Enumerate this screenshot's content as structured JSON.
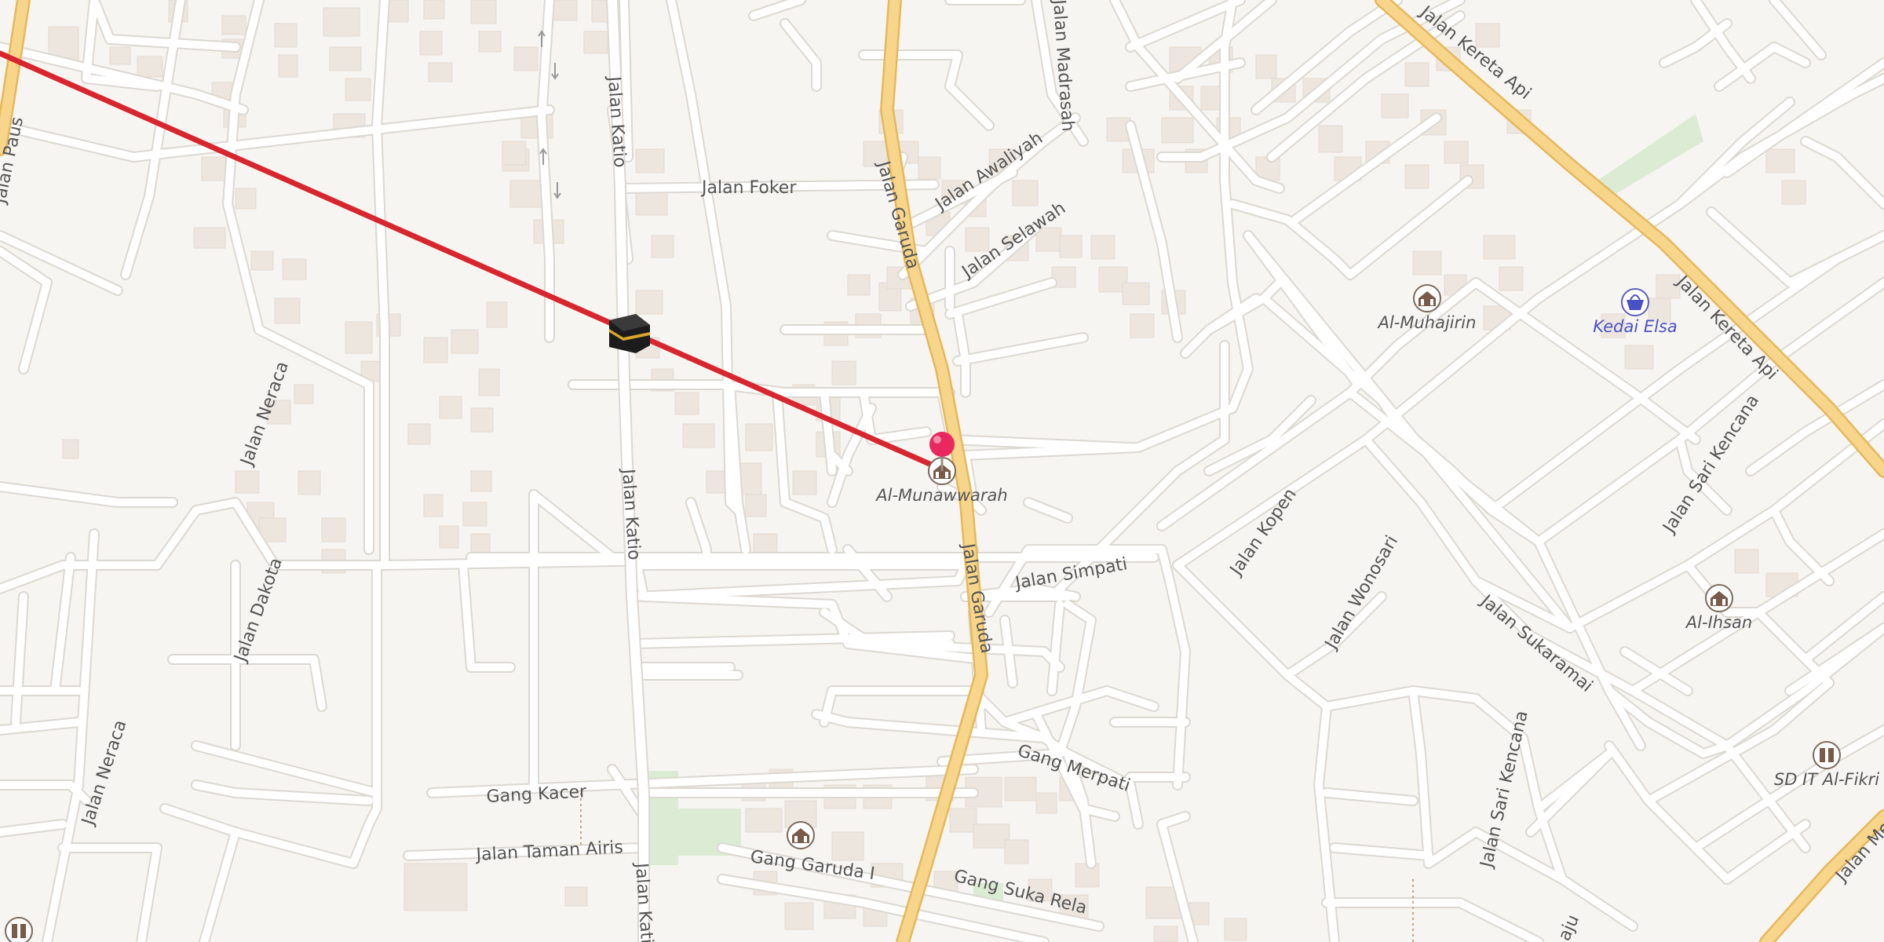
{
  "map": {
    "streets": {
      "paus": "Jalan Paus",
      "katio_top": "Jalan Katio",
      "katio_mid": "Jalan Katio",
      "katio_bot": "Jalan Kati",
      "foker": "Jalan Foker",
      "garuda_top": "Jalan Garuda",
      "garuda_mid": "Jalan Garuda",
      "madrasah": "Jalan Madrasah",
      "awaliyah": "Jalan Awaliyah",
      "selawah": "Jalan Selawah",
      "kereta_api_top": "Jalan Kereta Api",
      "kereta_api_mid": "Jalan Kereta Api",
      "neraca_top": "Jalan Neraca",
      "neraca_bot": "Jalan Neraca",
      "dakota": "Jalan Dakota",
      "simpati": "Jalan Simpati",
      "kopen": "Jalan Kopen",
      "wonosari": "Jalan Wonosari",
      "sukaramai": "Jalan Sukaramai",
      "sari_kencana_top": "Jalan Sari Kencana",
      "sari_kencana_bot": "Jalan Sari Kencana",
      "gang_kacer": "Gang Kacer",
      "gang_merpati": "Gang Merpati",
      "taman_airis": "Jalan Taman Airis",
      "gang_garuda": "Gang Garuda I",
      "gang_suka_rela": "Gang Suka Rela",
      "mer_edge": "Jalan Mer",
      "aju_edge": "aju"
    },
    "pois": {
      "munawwarah": "Al-Munawwarah",
      "muhajirin": "Al-Muhajirin",
      "kedai_elsa": "Kedai Elsa",
      "ihsan": "Al-Ihsan",
      "sd_it": "SD IT Al-Fikri"
    },
    "colors": {
      "background": "#f7f5f2",
      "road": "#ffffff",
      "road_casing": "#dcd8d2",
      "major_road": "#f7d58a",
      "major_casing": "#e6b85c",
      "building": "#ece6df",
      "park": "#dcebd3",
      "qibla_line": "#d7262e",
      "pin": "#e8285f"
    },
    "icons": {
      "kaaba": "kaaba-icon",
      "pin": "location-pin-icon",
      "mosque": "mosque-icon",
      "shop": "shopping-basket-icon",
      "school": "school-icon"
    }
  }
}
